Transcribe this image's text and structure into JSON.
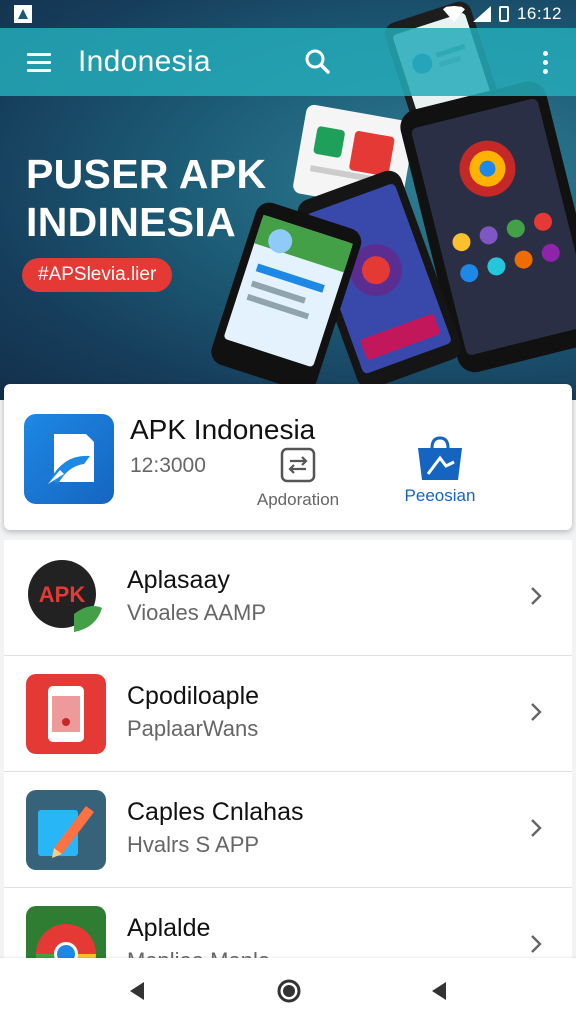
{
  "status_bar": {
    "time": "16:12"
  },
  "app_bar": {
    "title": "Indonesia"
  },
  "hero": {
    "headline_line1": "PUSER APK",
    "headline_line2": "INDINESIA",
    "tag": "#APSlevia.lier"
  },
  "app_card": {
    "name": "APK Indonesia",
    "count": "12:3000",
    "apply_label": "Apdoration",
    "share_label": "Peeosian"
  },
  "app_list": {
    "items": [
      {
        "title": "Aplasaay",
        "subtitle": "Vioales AAMP",
        "icon": "apk-bubble-icon"
      },
      {
        "title": "Cpodiloaple",
        "subtitle": "PaplaarWans",
        "icon": "phone-app-icon"
      },
      {
        "title": "Caples Cnlahas",
        "subtitle": "Hvalrs S APP",
        "icon": "edit-pencil-icon"
      },
      {
        "title": "Aplalde",
        "subtitle": "Mapliaa Manle",
        "icon": "chrome-browser-icon"
      }
    ]
  },
  "colors": {
    "app_bar": "#24aab8",
    "hero_bg": "#1c5a74",
    "tag_red": "#e53935",
    "brand_blue": "#1565c0"
  }
}
